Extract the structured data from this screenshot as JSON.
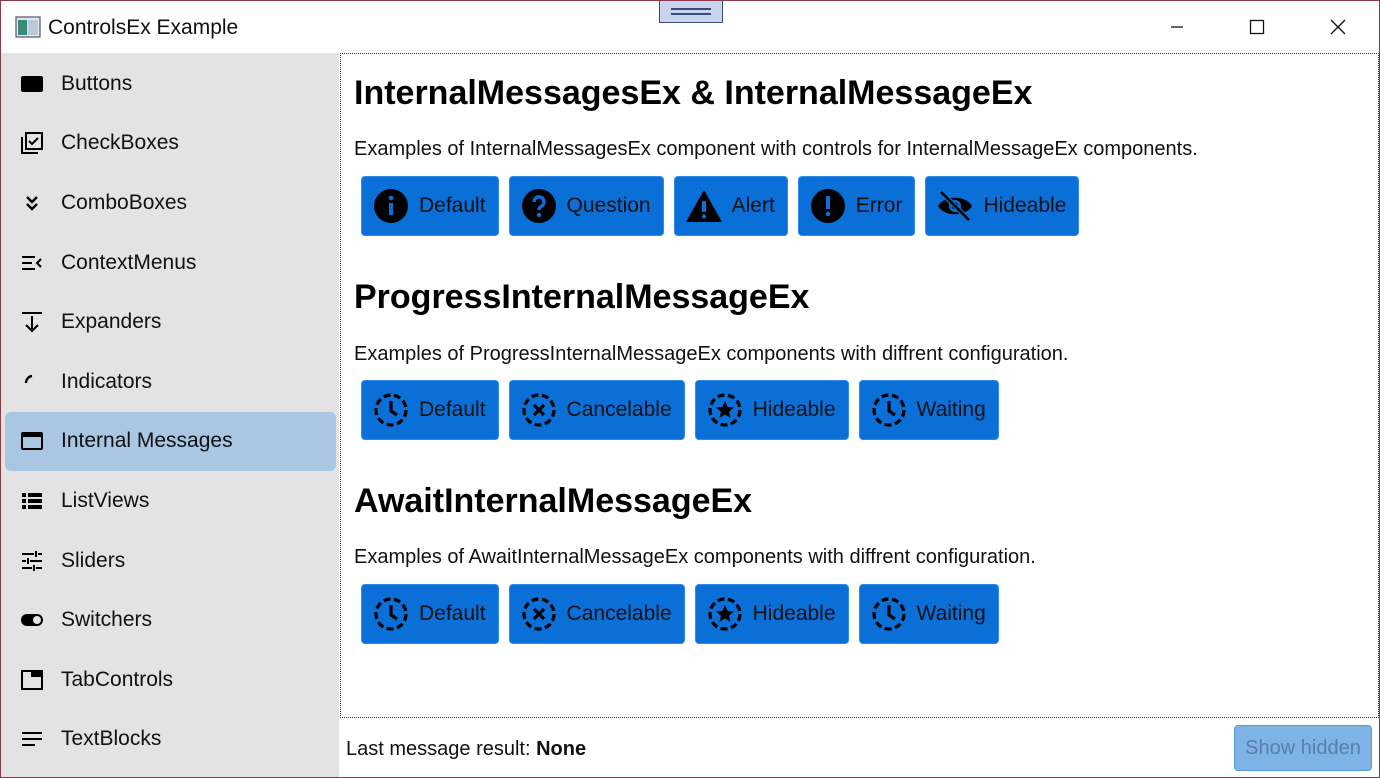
{
  "window": {
    "title": "ControlsEx Example"
  },
  "sidebar": {
    "items": [
      {
        "label": "Buttons",
        "icon": "button-icon",
        "selected": false
      },
      {
        "label": "CheckBoxes",
        "icon": "checkbox-multiple-icon",
        "selected": false
      },
      {
        "label": "ComboBoxes",
        "icon": "chevron-double-down-icon",
        "selected": false
      },
      {
        "label": "ContextMenus",
        "icon": "menu-open-icon",
        "selected": false
      },
      {
        "label": "Expanders",
        "icon": "arrow-collapse-down-icon",
        "selected": false
      },
      {
        "label": "Indicators",
        "icon": "loading-arc-icon",
        "selected": false
      },
      {
        "label": "Internal Messages",
        "icon": "window-icon",
        "selected": true
      },
      {
        "label": "ListViews",
        "icon": "list-icon",
        "selected": false
      },
      {
        "label": "Sliders",
        "icon": "tune-icon",
        "selected": false
      },
      {
        "label": "Switchers",
        "icon": "toggle-icon",
        "selected": false
      },
      {
        "label": "TabControls",
        "icon": "tab-icon",
        "selected": false
      },
      {
        "label": "TextBlocks",
        "icon": "text-lines-icon",
        "selected": false
      }
    ]
  },
  "sections": [
    {
      "title": "InternalMessagesEx & InternalMessageEx",
      "description": "Examples of InternalMessagesEx component with controls for InternalMessageEx components.",
      "buttons": [
        {
          "label": "Default",
          "icon": "info-icon"
        },
        {
          "label": "Question",
          "icon": "question-icon"
        },
        {
          "label": "Alert",
          "icon": "alert-icon"
        },
        {
          "label": "Error",
          "icon": "error-icon"
        },
        {
          "label": "Hideable",
          "icon": "eye-off-icon"
        }
      ]
    },
    {
      "title": "ProgressInternalMessageEx",
      "description": "Examples of ProgressInternalMessageEx components with diffrent configuration.",
      "buttons": [
        {
          "label": "Default",
          "icon": "clock-dashed-icon"
        },
        {
          "label": "Cancelable",
          "icon": "close-dashed-icon"
        },
        {
          "label": "Hideable",
          "icon": "star-dashed-icon"
        },
        {
          "label": "Waiting",
          "icon": "clock-dashed-icon"
        }
      ]
    },
    {
      "title": "AwaitInternalMessageEx",
      "description": "Examples of AwaitInternalMessageEx components with diffrent configuration.",
      "buttons": [
        {
          "label": "Default",
          "icon": "clock-dashed-icon"
        },
        {
          "label": "Cancelable",
          "icon": "close-dashed-icon"
        },
        {
          "label": "Hideable",
          "icon": "star-dashed-icon"
        },
        {
          "label": "Waiting",
          "icon": "clock-dashed-icon"
        }
      ]
    }
  ],
  "footer": {
    "result_label": "Last message result:",
    "result_value": "None",
    "show_hidden_label": "Show hidden"
  },
  "colors": {
    "accent": "#0a6fd6",
    "sidebar_bg": "#e3e3e3",
    "selected_bg": "#a9c6e2"
  }
}
